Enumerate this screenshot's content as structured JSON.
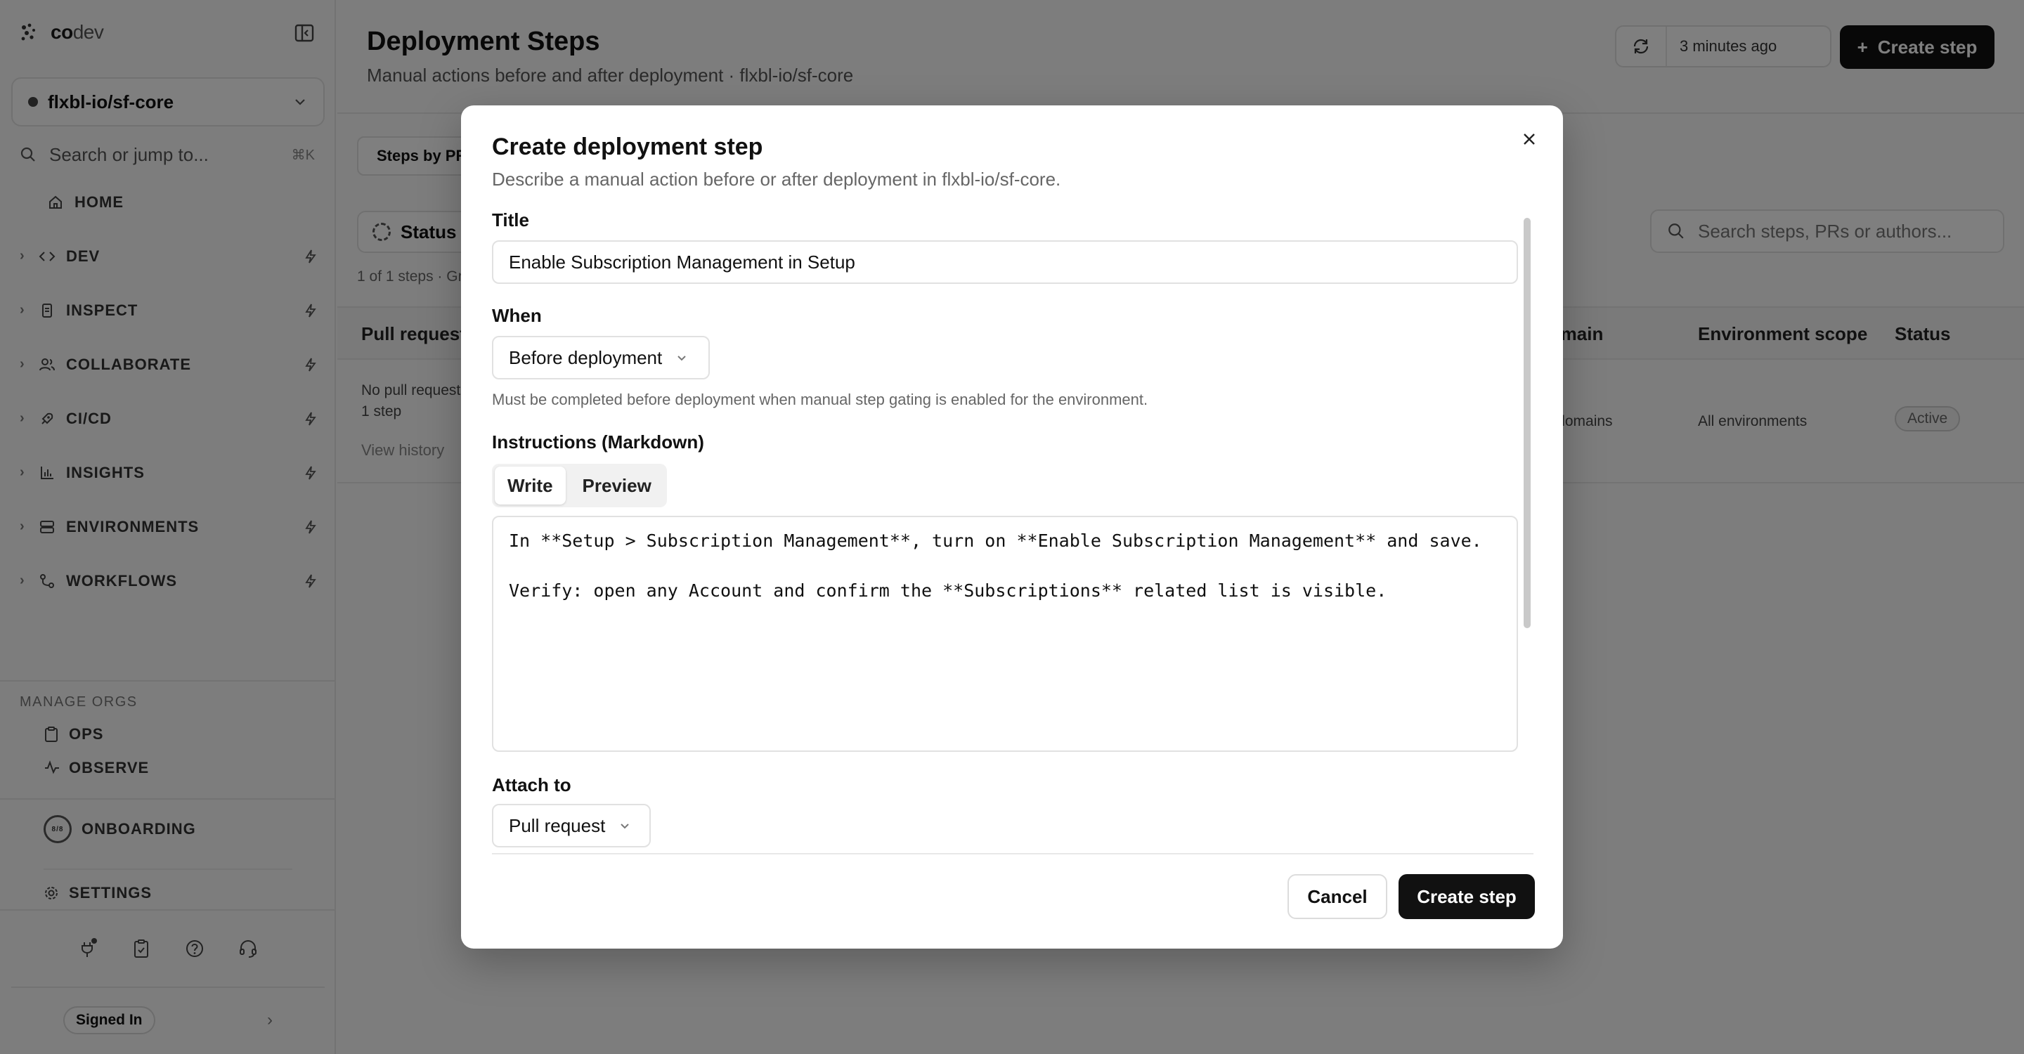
{
  "app": {
    "brand_bold": "co",
    "brand_rest": "dev"
  },
  "sidebar": {
    "repo": "flxbl-io/sf-core",
    "search_placeholder": "Search or jump to...",
    "search_shortcut": "⌘K",
    "home": "HOME",
    "items": [
      {
        "label": "DEV",
        "icon": "code-icon"
      },
      {
        "label": "INSPECT",
        "icon": "inspect-icon"
      },
      {
        "label": "COLLABORATE",
        "icon": "users-icon"
      },
      {
        "label": "CI/CD",
        "icon": "rocket-icon"
      },
      {
        "label": "INSIGHTS",
        "icon": "bar-chart-icon"
      },
      {
        "label": "ENVIRONMENTS",
        "icon": "server-icon"
      },
      {
        "label": "WORKFLOWS",
        "icon": "workflow-icon"
      }
    ],
    "manage_label": "MANAGE ORGS",
    "manage_items": [
      {
        "label": "OPS",
        "icon": "clipboard-icon"
      },
      {
        "label": "OBSERVE",
        "icon": "activity-icon"
      }
    ],
    "onboarding_progress": "8/8",
    "onboarding": "ONBOARDING",
    "settings": "SETTINGS",
    "signed_in": "Signed In"
  },
  "header": {
    "title": "Deployment Steps",
    "subtitle": "Manual actions before and after deployment · flxbl-io/sf-core",
    "refreshed": "3 minutes ago",
    "create_label": "Create step"
  },
  "toolbar": {
    "tab": "Steps by PR",
    "status_filter": "Status",
    "count": "1 of 1 steps · Gr",
    "search_placeholder": "Search steps, PRs or authors..."
  },
  "table": {
    "columns": {
      "pull_request": "Pull request",
      "domain": "Domain",
      "env_scope": "Environment scope",
      "status": "Status"
    },
    "row": {
      "pr_line1": "No pull request",
      "pr_line2": "1 step",
      "history": "View history",
      "domain": "All domains",
      "env_scope": "All environments",
      "status": "Active"
    }
  },
  "modal": {
    "title": "Create deployment step",
    "description": "Describe a manual action before or after deployment in flxbl-io/sf-core.",
    "title_label": "Title",
    "title_value": "Enable Subscription Management in Setup",
    "when_label": "When",
    "when_value": "Before deployment",
    "when_help": "Must be completed before deployment when manual step gating is enabled for the environment.",
    "instructions_label": "Instructions (Markdown)",
    "tab_write": "Write",
    "tab_preview": "Preview",
    "instructions_value": "In **Setup > Subscription Management**, turn on **Enable Subscription Management** and save.\n\nVerify: open any Account and confirm the **Subscriptions** related list is visible.",
    "attach_label": "Attach to",
    "attach_value": "Pull request",
    "cancel_label": "Cancel",
    "submit_label": "Create step"
  }
}
